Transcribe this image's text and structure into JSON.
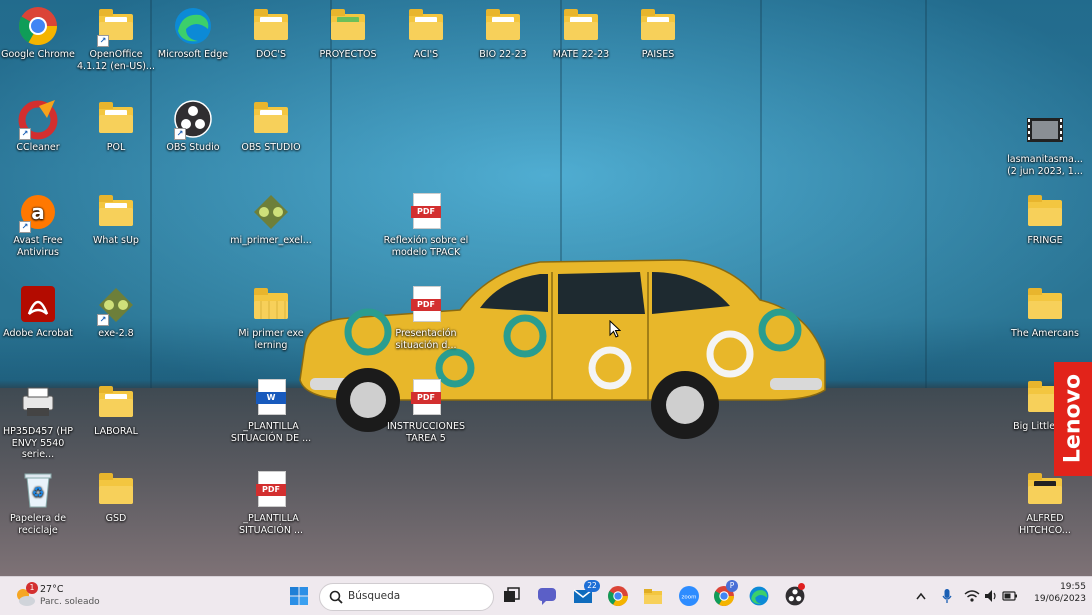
{
  "desktop": {
    "icons": [
      {
        "label": "Google Chrome",
        "icon": "chrome-icon"
      },
      {
        "label": "OpenOffice 4.1.12 (en-US)...",
        "icon": "openoffice-folder-icon"
      },
      {
        "label": "Microsoft Edge",
        "icon": "edge-icon"
      },
      {
        "label": "DOC'S",
        "icon": "folder-icon"
      },
      {
        "label": "PROYECTOS",
        "icon": "folder-icon"
      },
      {
        "label": "ACI'S",
        "icon": "folder-icon"
      },
      {
        "label": "BIO 22-23",
        "icon": "folder-icon"
      },
      {
        "label": "MATE 22-23",
        "icon": "folder-icon"
      },
      {
        "label": "PAISES",
        "icon": "folder-icon"
      },
      {
        "label": "CCleaner",
        "icon": "ccleaner-icon"
      },
      {
        "label": "POL",
        "icon": "folder-icon"
      },
      {
        "label": "OBS Studio",
        "icon": "obs-icon"
      },
      {
        "label": "OBS STUDIO",
        "icon": "folder-icon"
      },
      {
        "label": "lasmanitasma... (2 jun 2023, 1...",
        "icon": "video-file-icon"
      },
      {
        "label": "Avast Free Antivirus",
        "icon": "avast-icon"
      },
      {
        "label": "What sUp",
        "icon": "folder-icon"
      },
      {
        "label": "mi_primer_exel...",
        "icon": "exelearning-icon"
      },
      {
        "label": "Reflexión sobre el modelo TPACK",
        "icon": "pdf-icon"
      },
      {
        "label": "FRINGE",
        "icon": "folder-icon"
      },
      {
        "label": "Adobe Acrobat",
        "icon": "acrobat-icon"
      },
      {
        "label": "exe-2.8",
        "icon": "exelearning-icon"
      },
      {
        "label": "Mi primer exe lerning",
        "icon": "zip-folder-icon"
      },
      {
        "label": "Presentación situación d...",
        "icon": "pdf-icon"
      },
      {
        "label": "The Amercans",
        "icon": "folder-icon"
      },
      {
        "label": "HP35D457 (HP ENVY 5540 serie...",
        "icon": "printer-icon"
      },
      {
        "label": "LABORAL",
        "icon": "folder-icon"
      },
      {
        "label": "_PLANTILLA SITUACIÓN DE ...",
        "icon": "word-icon"
      },
      {
        "label": "INSTRUCCIONES TAREA 5",
        "icon": "pdf-icon"
      },
      {
        "label": "Big Little Lies",
        "icon": "folder-icon"
      },
      {
        "label": "Papelera de reciclaje",
        "icon": "recycle-bin-icon"
      },
      {
        "label": "GSD",
        "icon": "folder-icon"
      },
      {
        "label": "_PLANTILLA SITUACIÓN ...",
        "icon": "pdf-icon"
      },
      {
        "label": "ALFRED HITCHCO...",
        "icon": "folder-icon"
      }
    ],
    "pdf_tag": "PDF",
    "word_tag": "W",
    "brand": "Lenovo",
    "colors": {
      "folder": "#f3c640",
      "wall": "#3a9cc4",
      "car": "#e8b72a",
      "accent": "#e2231a"
    }
  },
  "taskbar": {
    "weather": {
      "temp": "27°C",
      "condition": "Parc. soleado",
      "badge": "1"
    },
    "search_placeholder": "Búsqueda",
    "apps": [
      "start-icon",
      "task-view-icon",
      "chat-icon",
      "mail-icon",
      "chrome-icon",
      "file-explorer-icon",
      "zoom-icon",
      "chrome-profile-icon",
      "edge-icon",
      "obs-icon"
    ],
    "mail_badge": "22",
    "chrome_profile_badge": "P",
    "zoom_label": "zoom",
    "clock": {
      "time": "19:55",
      "date": "19/06/2023"
    }
  }
}
